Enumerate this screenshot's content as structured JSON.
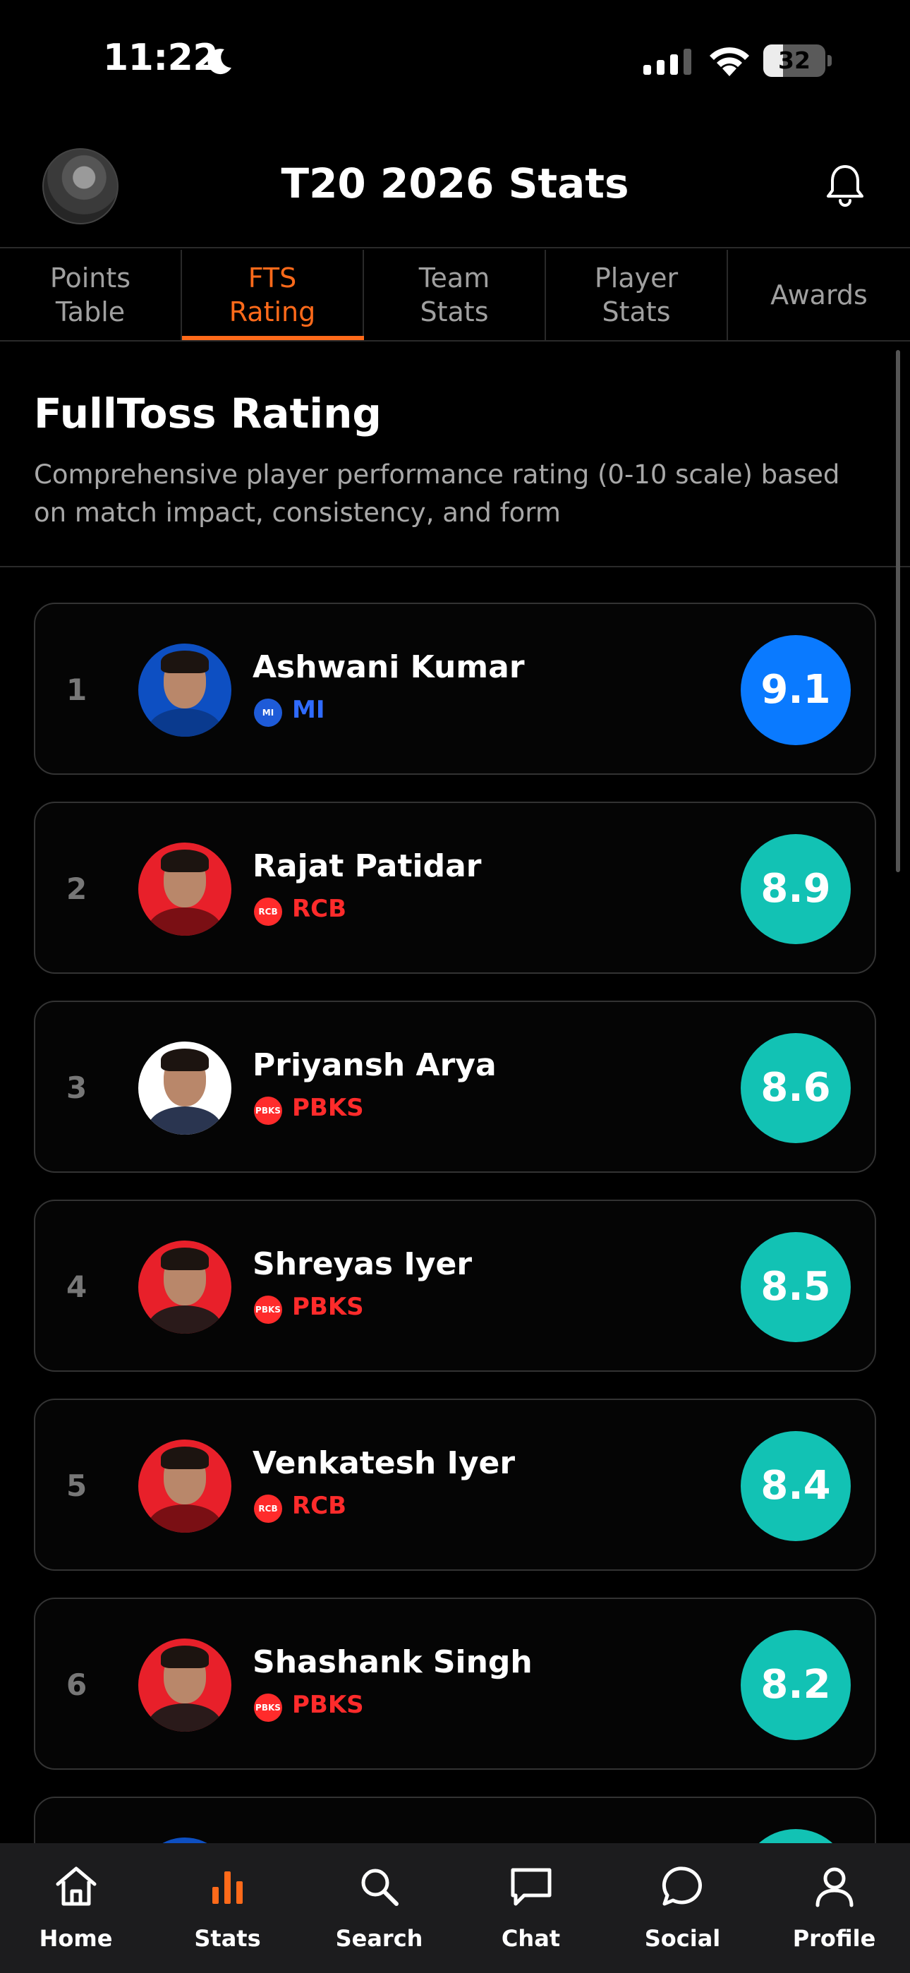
{
  "status_bar": {
    "time": "11:22",
    "battery": "32",
    "battery_level": 0.32
  },
  "header": {
    "title": "T20 2026 Stats"
  },
  "tabs": [
    {
      "label": "Points\nTable",
      "active": false
    },
    {
      "label": "FTS\nRating",
      "active": true
    },
    {
      "label": "Team\nStats",
      "active": false
    },
    {
      "label": "Player\nStats",
      "active": false
    },
    {
      "label": "Awards",
      "active": false
    }
  ],
  "section": {
    "title": "FullToss Rating",
    "description": "Comprehensive player performance rating (0-10 scale) based on match impact, consistency, and form"
  },
  "players": [
    {
      "rank": "1",
      "name": "Ashwani Kumar",
      "team": "MI",
      "team_logo_text": "MI",
      "rating": "9.1",
      "team_color": "#1e5bd8",
      "photo_bg": "#0d4fc2",
      "jersey": "#0a3a8e",
      "score_color": "#0a7aff"
    },
    {
      "rank": "2",
      "name": "Rajat Patidar",
      "team": "RCB",
      "team_logo_text": "RCB",
      "rating": "8.9",
      "team_color": "#ff2b2b",
      "photo_bg": "#e8202a",
      "jersey": "#7a0f14",
      "score_color": "#12c2b4"
    },
    {
      "rank": "3",
      "name": "Priyansh Arya",
      "team": "PBKS",
      "team_logo_text": "PBKS",
      "rating": "8.6",
      "team_color": "#ff2b2b",
      "photo_bg": "#ffffff",
      "jersey": "#2a3550",
      "score_color": "#12c2b4"
    },
    {
      "rank": "4",
      "name": "Shreyas Iyer",
      "team": "PBKS",
      "team_logo_text": "PBKS",
      "rating": "8.5",
      "team_color": "#ff2b2b",
      "photo_bg": "#e8202a",
      "jersey": "#2a1a1a",
      "score_color": "#12c2b4"
    },
    {
      "rank": "5",
      "name": "Venkatesh Iyer",
      "team": "RCB",
      "team_logo_text": "RCB",
      "rating": "8.4",
      "team_color": "#ff2b2b",
      "photo_bg": "#e8202a",
      "jersey": "#7a0f14",
      "score_color": "#12c2b4"
    },
    {
      "rank": "6",
      "name": "Shashank Singh",
      "team": "PBKS",
      "team_logo_text": "PBKS",
      "rating": "8.2",
      "team_color": "#ff2b2b",
      "photo_bg": "#e8202a",
      "jersey": "#2a1a1a",
      "score_color": "#12c2b4"
    },
    {
      "rank": "",
      "name": "",
      "team": "",
      "team_logo_text": "",
      "rating": "",
      "team_color": "#1e5bd8",
      "photo_bg": "#0d4fc2",
      "jersey": "#0a3a8e",
      "score_color": "#12c2b4"
    }
  ],
  "bottom_nav": [
    {
      "label": "Home",
      "icon": "home-icon"
    },
    {
      "label": "Stats",
      "icon": "stats-icon",
      "active": true
    },
    {
      "label": "Search",
      "icon": "search-icon"
    },
    {
      "label": "Chat",
      "icon": "chat-icon"
    },
    {
      "label": "Social",
      "icon": "social-icon"
    },
    {
      "label": "Profile",
      "icon": "profile-icon"
    }
  ],
  "colors": {
    "accent": "#ff6a1a",
    "score_top": "#0a7aff",
    "score": "#12c2b4",
    "nav_bg": "#1c1c1e"
  }
}
